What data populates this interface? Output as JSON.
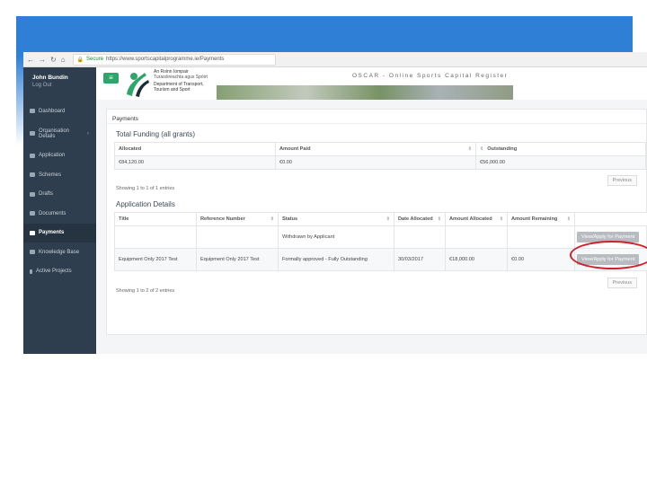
{
  "browser": {
    "url_secure": "Secure",
    "url": "https://www.sportscapitalprogramme.ie/Payments"
  },
  "sidebar": {
    "user_name": "John Bundin",
    "logout": "Log Out",
    "items": [
      {
        "label": "Dashboard"
      },
      {
        "label": "Organisation Details"
      },
      {
        "label": "Application"
      },
      {
        "label": "Schemes"
      },
      {
        "label": "Drafts"
      },
      {
        "label": "Documents"
      },
      {
        "label": "Payments"
      },
      {
        "label": "Knowledge Base"
      },
      {
        "label": "Active Projects"
      }
    ]
  },
  "header": {
    "dept_irish_1": "An Roinn Iompair",
    "dept_irish_2": "Turasóireachta agus Spóirt",
    "dept_en_1": "Department of Transport,",
    "dept_en_2": "Tourism and Sport",
    "title": "OSCAR - Online Sports Capital Register"
  },
  "main": {
    "page_title": "Payments",
    "total_funding": {
      "title": "Total Funding (all grants)",
      "headers": [
        "Allocated",
        "Amount Paid",
        "Outstanding"
      ],
      "row": [
        "€84,120.00",
        "€0.00",
        "€56,000.00"
      ],
      "showing": "Showing 1 to 1 of 1 entries",
      "prev": "Previous"
    },
    "application_details": {
      "title": "Application Details",
      "headers": [
        "Title",
        "Reference Number",
        "Status",
        "Date Allocated",
        "Amount Allocated",
        "Amount Remaining"
      ],
      "rows": [
        [
          "",
          "",
          "Withdrawn by Applicant",
          "",
          "",
          ""
        ],
        [
          "Equipment Only 2017 Test",
          "Equipment Only 2017 Test",
          "Formally approved - Fully Outstanding",
          "30/03/2017",
          "€18,000.00",
          "€0.00"
        ]
      ],
      "button_label": "View/Apply for Payment",
      "showing": "Showing 1 to 2 of 2 entries",
      "prev": "Previous"
    }
  },
  "colors": {
    "accent": "#2f7fd6",
    "sidebar": "#2f3e4e",
    "brand_green": "#2ea66a",
    "highlight_ring": "#d0202a"
  }
}
